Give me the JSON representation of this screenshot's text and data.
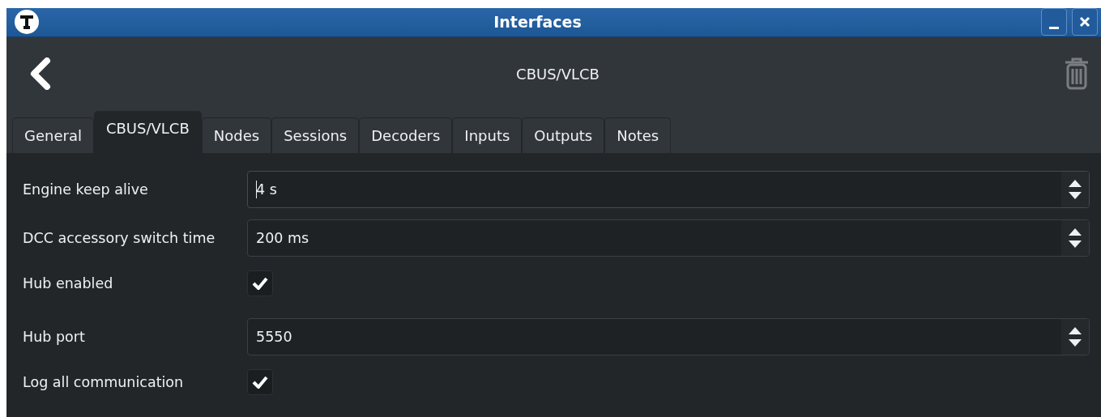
{
  "window": {
    "title": "Interfaces"
  },
  "header": {
    "title": "CBUS/VLCB"
  },
  "tabs": [
    {
      "label": "General",
      "selected": false
    },
    {
      "label": "CBUS/VLCB",
      "selected": true
    },
    {
      "label": "Nodes",
      "selected": false
    },
    {
      "label": "Sessions",
      "selected": false
    },
    {
      "label": "Decoders",
      "selected": false
    },
    {
      "label": "Inputs",
      "selected": false
    },
    {
      "label": "Outputs",
      "selected": false
    },
    {
      "label": "Notes",
      "selected": false
    }
  ],
  "fields": [
    {
      "kind": "spin",
      "label": "Engine keep alive",
      "value": "4 s",
      "focused": true
    },
    {
      "kind": "spin",
      "label": "DCC accessory switch time",
      "value": "200 ms",
      "focused": false
    },
    {
      "kind": "checkbox",
      "label": "Hub enabled",
      "checked": true
    },
    {
      "kind": "spin",
      "label": "Hub port",
      "value": "5550",
      "focused": false
    },
    {
      "kind": "checkbox",
      "label": "Log all communication",
      "checked": true
    }
  ]
}
